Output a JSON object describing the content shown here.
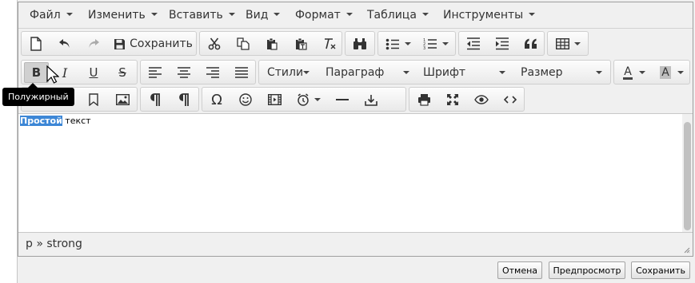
{
  "menubar": {
    "items": [
      {
        "label": "Файл"
      },
      {
        "label": "Изменить"
      },
      {
        "label": "Вставить"
      },
      {
        "label": "Вид"
      },
      {
        "label": "Формат"
      },
      {
        "label": "Таблица"
      },
      {
        "label": "Инструменты"
      }
    ]
  },
  "toolbar": {
    "save_label": "Сохранить",
    "styles_label": "Стили",
    "paragraph_label": "Параграф",
    "font_label": "Шрифт",
    "size_label": "Размер",
    "font_color_label": "A",
    "bg_color_label": "A",
    "bold_label": "B",
    "italic_label": "I",
    "underline_label": "U",
    "strike_label": "S"
  },
  "tooltip": {
    "text": "Полужирный"
  },
  "content": {
    "selected_text": "Простой",
    "rest_text": " текст"
  },
  "statusbar": {
    "path": "p » strong"
  },
  "footer": {
    "cancel_label": "Отмена",
    "preview_label": "Предпросмотр",
    "save_label": "Сохранить"
  }
}
